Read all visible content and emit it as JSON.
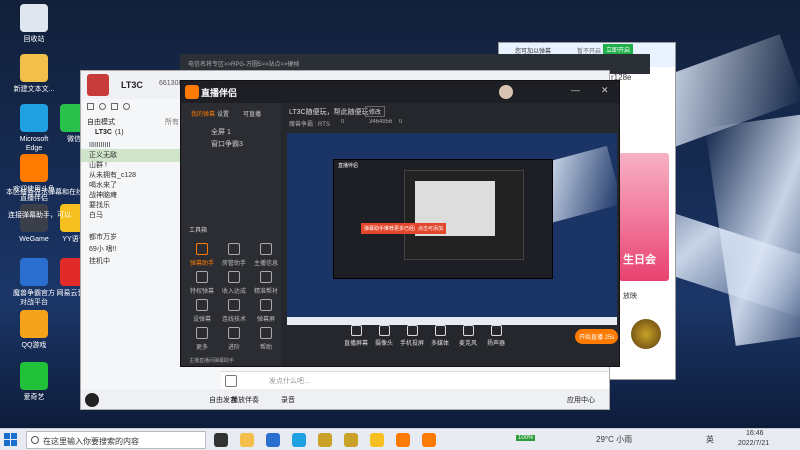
{
  "desktop": {
    "icons": [
      {
        "label": "回收站",
        "icon": "recycle-bin-icon",
        "color": "#dfe6ee"
      },
      {
        "label": "新建文本文...",
        "icon": "text-file-icon",
        "color": "#f2c04a"
      },
      {
        "label": "Microsoft\nEdge",
        "icon": "edge-icon",
        "color": "#1fa0e0"
      },
      {
        "label": "微信",
        "icon": "wechat-icon",
        "color": "#2ac14a"
      },
      {
        "label": "欢迎使用斗鱼\n直播伴侣",
        "icon": "douyu-icon",
        "color": "#ff7a00"
      },
      {
        "label": "WeGame",
        "icon": "wegame-icon",
        "color": "#3a3f4a"
      },
      {
        "label": "YY语音",
        "icon": "yy-icon",
        "color": "#f6c021"
      },
      {
        "label": "魔兽争霸官方\n对战平台",
        "icon": "warcraft-icon",
        "color": "#2a6fd0"
      },
      {
        "label": "网易云音乐",
        "icon": "netease-music-icon",
        "color": "#e12b2b"
      },
      {
        "label": "QQ游戏",
        "icon": "qq-game-icon",
        "color": "#f5a31a"
      },
      {
        "label": "爱奇艺",
        "icon": "iqiyi-icon",
        "color": "#21c13a"
      }
    ],
    "overlay_texts": [
      "本区域会显示弹幕和在线观众",
      "连接弹幕助手，可以"
    ]
  },
  "yy": {
    "title": "LT3C",
    "channel_id": "661308",
    "mode": "自由模式",
    "channel_count": "所有",
    "user_avatar_label": "LT3C",
    "channel_label": "LT3C",
    "channel_count2": "(1)",
    "members": [
      {
        "name": "IIIIIIIIIII"
      },
      {
        "name": "正义无敌",
        "highlight": true
      },
      {
        "name": "山群 !"
      },
      {
        "name": "从未拥有_c128"
      },
      {
        "name": "喝水来了"
      },
      {
        "name": "战神脑瘫"
      },
      {
        "name": "要找乐"
      },
      {
        "name": "白马"
      }
    ],
    "subchannels": [
      "都市万岁",
      "69小 嗜!!",
      "挂机中"
    ],
    "input_placeholder": "发点什么吧...",
    "bottom_items": [
      "自由发言",
      "播放伴奏",
      "录音"
    ],
    "app_center": "应用中心"
  },
  "bg_window": {
    "breadcrumb": "电信名将专区>>RPG-万圆5>>站点>>硬帧",
    "notify_title": "您可加以弹幕",
    "notify_action": "立即开启",
    "notify_dismiss": "暂不开启",
    "user_id": "r128e",
    "banner_text": "生日会",
    "side_label": "放映"
  },
  "streamer": {
    "title": "直播伴侣",
    "room_title": "LT3C随便玩，帮此随便玩",
    "edit_label": "修改",
    "tabs": [
      "我的弹幕",
      "设置",
      "可直播"
    ],
    "sources": [
      "全屏 1",
      "窗口争霸3"
    ],
    "stats": [
      "魔兽争霸 : RTS",
      "0",
      "3464956",
      "0"
    ],
    "tools_label": "工具箱",
    "tools": [
      "弹幕助手",
      "房管助手",
      "主播信息",
      "特权弹幕",
      "收入达成",
      "精准帮衬",
      "设弹幕",
      "连线技术",
      "弹幕屏",
      "更多",
      "进阶",
      "帮助"
    ],
    "controls": [
      "直播屏幕",
      "摄像头",
      "手机投屏",
      "多媒体",
      "麦克风",
      "扬声器"
    ],
    "start_button": "开始直播 25s",
    "alert_text": "主播直播间弹幕助手",
    "in_preview": {
      "title": "直播伴侣",
      "alert": "弹幕助手推荐更多已经成功",
      "alert_btn": "点击可添加"
    }
  },
  "taskbar": {
    "search_placeholder": "在这里输入你要搜索的内容",
    "battery": "100%",
    "weather": "29°C 小雨",
    "lang": "英",
    "time": "16:46",
    "date": "2022/7/21",
    "apps": [
      {
        "name": "task-view-icon",
        "color": "#333"
      },
      {
        "name": "file-explorer-icon",
        "color": "#f2c04a"
      },
      {
        "name": "store-icon",
        "color": "#2a6fd0"
      },
      {
        "name": "edge-taskbar-icon",
        "color": "#1fa0e0"
      },
      {
        "name": "warcraft-taskbar-icon",
        "color": "#c9a227"
      },
      {
        "name": "warcraft2-taskbar-icon",
        "color": "#c9a227"
      },
      {
        "name": "yy-taskbar-icon",
        "color": "#f6c021"
      },
      {
        "name": "douyu-taskbar-icon",
        "color": "#ff7a00"
      },
      {
        "name": "douyu2-taskbar-icon",
        "color": "#ff7a00"
      }
    ]
  }
}
